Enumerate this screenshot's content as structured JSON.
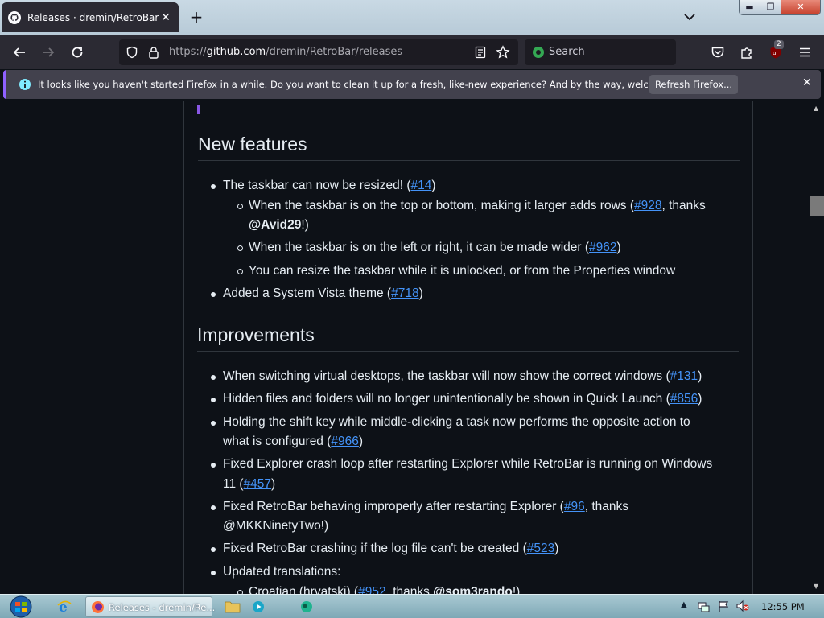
{
  "browser": {
    "tab": {
      "title": "Releases · dremin/RetroBar",
      "close": "✕"
    },
    "new_tab": "+",
    "url": {
      "prefix": "https://",
      "host": "github.com",
      "path": "/dremin/RetroBar/releases"
    },
    "search_placeholder": "Search",
    "extension_badge": "2",
    "window_controls": {
      "minimize": "▬",
      "maximize": "❐",
      "close": "✕"
    }
  },
  "notification": {
    "text": "It looks like you haven't started Firefox in a while. Do you want to clean it up for a fresh, like-new experience? And by the way, welcome back!",
    "button": "Refresh Firefox...",
    "close": "✕"
  },
  "content": {
    "new_features": {
      "heading": "New features",
      "items": [
        {
          "text_a": "The taskbar can now be resized! (",
          "link": "#14",
          "text_b": ")"
        },
        {
          "text_a": "When the taskbar is on the top or bottom, making it larger adds rows (",
          "link": "#928",
          "text_b": ", thanks",
          "mention": "@Avid29",
          "text_c": "!)"
        },
        {
          "text_a": "When the taskbar is on the left or right, it can be made wider (",
          "link": "#962",
          "text_b": ")"
        },
        {
          "text_a": "You can resize the taskbar while it is unlocked, or from the Properties window"
        },
        {
          "text_a": "Added a System Vista theme (",
          "link": "#718",
          "text_b": ")"
        }
      ]
    },
    "improvements": {
      "heading": "Improvements",
      "items": [
        {
          "text_a": "When switching virtual desktops, the taskbar will now show the correct windows (",
          "link": "#131",
          "text_b": ")"
        },
        {
          "text_a": "Hidden files and folders will no longer unintentionally be shown in Quick Launch (",
          "link": "#856",
          "text_b": ")"
        },
        {
          "text_a": "Holding the shift key while middle-clicking a task now performs the opposite action to",
          "text_a2": "what is configured (",
          "link": "#966",
          "text_b": ")"
        },
        {
          "text_a": "Fixed Explorer crash loop after restarting Explorer while RetroBar is running on Windows",
          "text_a2": "11 (",
          "link": "#457",
          "text_b": ")"
        },
        {
          "text_a": "Fixed RetroBar behaving improperly after restarting Explorer (",
          "link": "#96",
          "text_b": ", thanks",
          "text_a2": "@MKKNinetyTwo!)"
        },
        {
          "text_a": "Fixed RetroBar crashing if the log file can't be created (",
          "link": "#523",
          "text_b": ")"
        },
        {
          "text_a": "Updated translations:"
        },
        {
          "text_a": "Croatian (hrvatski) (",
          "link": "#952",
          "text_b": ", thanks ",
          "mention": "@som3rando",
          "text_c": "!)"
        }
      ]
    }
  },
  "taskbar": {
    "active_window": "Releases - dremin/Re...",
    "clock": "12:55 PM"
  }
}
